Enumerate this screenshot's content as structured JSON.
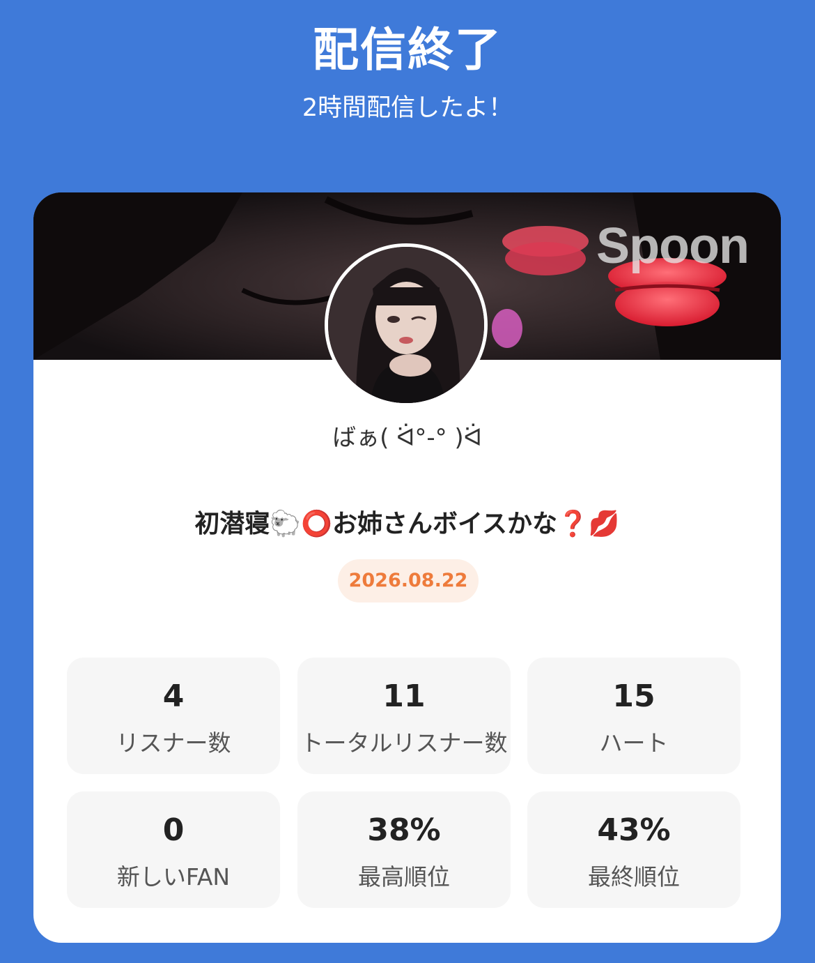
{
  "header": {
    "title": "配信終了",
    "subtitle": "2時間配信したよ！"
  },
  "banner": {
    "logo_text": "Spoon"
  },
  "profile": {
    "username": "ばぁ( ᐛ°-° )ᐛ"
  },
  "live": {
    "title": "初潜寝🐑⭕お姉さんボイスかな❓💋",
    "date": "2026.08.22"
  },
  "stats": [
    {
      "value": "4",
      "label": "リスナー数"
    },
    {
      "value": "11",
      "label": "トータルリスナー数"
    },
    {
      "value": "15",
      "label": "ハート"
    },
    {
      "value": "0",
      "label": "新しいFAN"
    },
    {
      "value": "38%",
      "label": "最高順位"
    },
    {
      "value": "43%",
      "label": "最終順位"
    }
  ],
  "colors": {
    "background": "#3f7ad9",
    "card": "#ffffff",
    "date_badge_bg": "#fdefe6",
    "date_badge_text": "#ee7b3b",
    "stat_bg": "#f6f6f6"
  },
  "icons": [
    "lips-icon",
    "kiss-mark-icon"
  ]
}
